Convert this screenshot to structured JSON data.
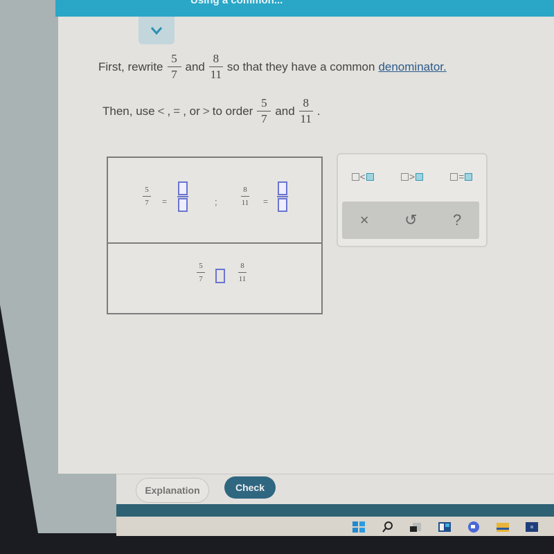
{
  "header": {
    "title_partial": "Using a common..."
  },
  "prompt": {
    "line1": {
      "prefix": "First, rewrite",
      "frac_a": {
        "num": "5",
        "den": "7"
      },
      "conj": "and",
      "frac_b": {
        "num": "8",
        "den": "11"
      },
      "suffix": "so that they have a common",
      "link": "denominator."
    },
    "line2": {
      "prefix": "Then, use",
      "lt": "<",
      "comma1": ",",
      "eq": "=",
      "comma2": ", or",
      "gt": ">",
      "mid": "to order",
      "frac_a": {
        "num": "5",
        "den": "7"
      },
      "conj": "and",
      "frac_b": {
        "num": "8",
        "den": "11"
      },
      "end": "."
    }
  },
  "answer": {
    "row1": {
      "frac_a": {
        "num": "5",
        "den": "7"
      },
      "frac_b": {
        "num": "8",
        "den": "11"
      },
      "equals": "=",
      "separator": ";",
      "input_a_num": "",
      "input_a_den": "",
      "input_b_num": "",
      "input_b_den": ""
    },
    "row2": {
      "frac_a": {
        "num": "5",
        "den": "7"
      },
      "frac_b": {
        "num": "8",
        "den": "11"
      },
      "compare_input": ""
    }
  },
  "keypad": {
    "ops": [
      "<",
      ">",
      "="
    ],
    "actions": {
      "clear": "×",
      "undo": "↺",
      "help": "?"
    }
  },
  "footer": {
    "explanation_label": "Explanation",
    "check_label": "Check"
  },
  "taskbar": {
    "icons": [
      "windows-start-icon",
      "search-icon",
      "task-view-icon",
      "widgets-icon",
      "chat-icon",
      "file-explorer-icon",
      "store-icon"
    ]
  },
  "colors": {
    "header": "#2aa6c7",
    "check_button": "#2f6680",
    "input_border": "#6a74d0",
    "keypad_accent": "#3a95b0"
  }
}
